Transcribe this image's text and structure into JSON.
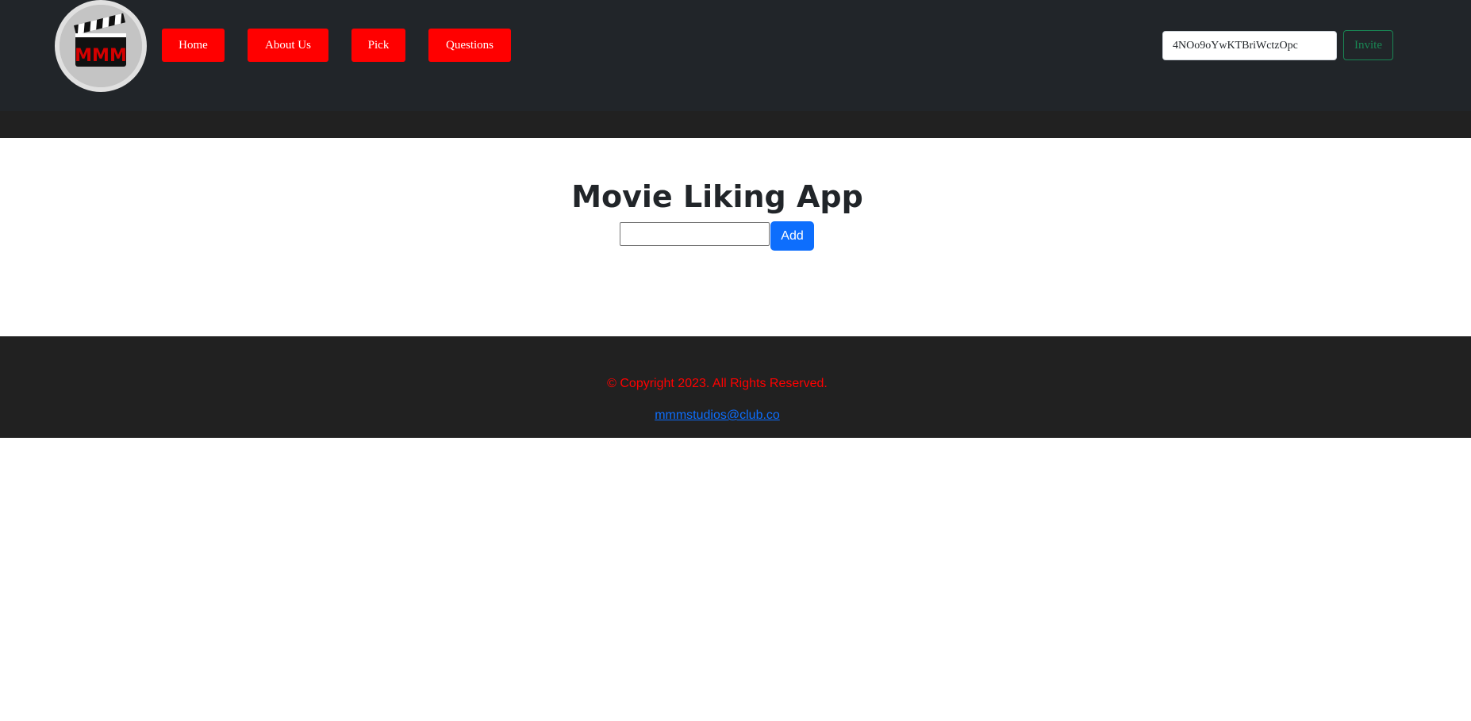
{
  "logo": {
    "text": "MMM"
  },
  "nav": {
    "home": "Home",
    "about": "About Us",
    "pick": "Pick",
    "questions": "Questions"
  },
  "invite": {
    "code_value": "4NOo9oYwKTBriWctzOpc",
    "button_label": "Invite"
  },
  "main": {
    "title": "Movie Liking App",
    "movie_input_value": "",
    "add_label": "Add"
  },
  "footer": {
    "copyright": "© Copyright 2023. All Rights Reserved.",
    "email": "mmmstudios@club.co"
  },
  "colors": {
    "header_bg": "#212529",
    "nav_button": "#ff0000",
    "invite_outline": "#198754",
    "add_button": "#0d6efd",
    "footer_bg": "#212121",
    "copyright_text": "#ff0000",
    "link": "#0d6efd"
  },
  "icons": {
    "logo": "clapperboard-icon"
  }
}
